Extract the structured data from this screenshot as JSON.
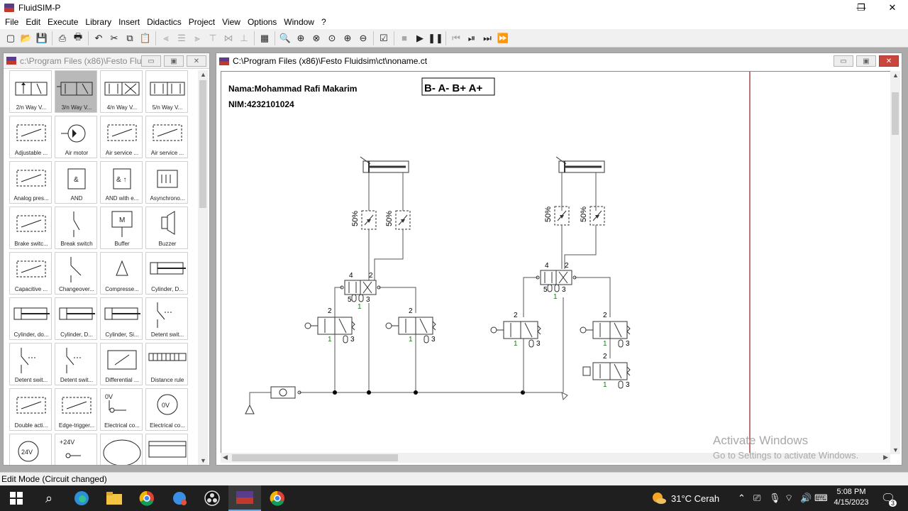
{
  "app": {
    "title": "FluidSIM-P"
  },
  "window_controls": {
    "minimize": "—",
    "maximize": "❐",
    "close": "✕"
  },
  "menu": [
    "File",
    "Edit",
    "Execute",
    "Library",
    "Insert",
    "Didactics",
    "Project",
    "View",
    "Options",
    "Window",
    "?"
  ],
  "library_window": {
    "title": "c:\\Program Files (x86)\\Festo Flu...",
    "items": [
      "2/n Way V...",
      "3/n Way V...",
      "4/n Way V...",
      "5/n Way V...",
      "Adjustable ...",
      "Air motor",
      "Air service ...",
      "Air service ...",
      "Analog pres...",
      "AND",
      "AND with e...",
      "Asynchrono...",
      "Brake switc...",
      "Break switch",
      "Buffer",
      "Buzzer",
      "Capacitive ...",
      "Changeover...",
      "Compresse...",
      "Cylinder, D...",
      "Cylinder, do...",
      "Cylinder, D...",
      "Cylinder, Si...",
      "Detent swit...",
      "Detent swit...",
      "Detent swit...",
      "Differential ...",
      "Distance rule",
      "Double acti...",
      "Edge-trigger...",
      "Electrical co...",
      "Electrical co...",
      "",
      "",
      "",
      ""
    ],
    "selected_index": 1,
    "cell_text": {
      "and": "&",
      "and_e": "& ↑",
      "buffer": "M",
      "ov1": "0V",
      "ov2": "0V",
      "v24": "24V",
      "v24b": "+24V"
    }
  },
  "circuit_window": {
    "title": "C:\\Program Files (x86)\\Festo Fluidsim\\ct\\noname.ct",
    "name_label": "Nama:Mohammad  Rafi  Makarim",
    "nim_label": "NIM:4232101024",
    "sequence": "B-  A-  B+  A+",
    "throttle_label": "50%",
    "ports": {
      "p2": "2",
      "p4": "4",
      "p5": "5",
      "p3": "3",
      "p1": "1"
    }
  },
  "status": {
    "text": "Edit Mode (Circuit changed)"
  },
  "watermark": {
    "line1": "Activate Windows",
    "line2": "Go to Settings to activate Windows."
  },
  "taskbar": {
    "weather": "31°C  Cerah",
    "time": "5:08 PM",
    "date": "4/15/2023",
    "notifications": "3"
  },
  "colors": {
    "port_number_green": "#1a7a1a",
    "canvas_border_red": "#8b1a1a",
    "taskbar": "#1f1f1f"
  }
}
